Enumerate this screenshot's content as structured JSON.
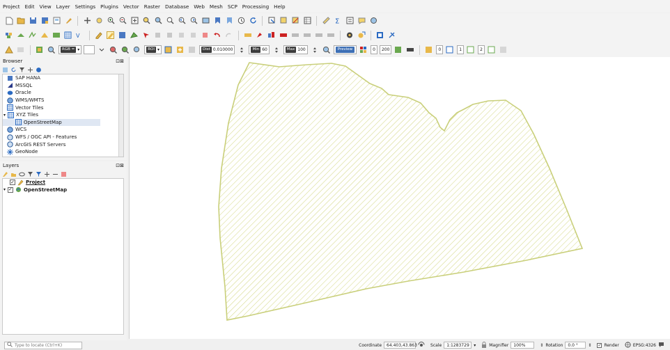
{
  "menubar": [
    "Project",
    "Edit",
    "View",
    "Layer",
    "Settings",
    "Plugins",
    "Vector",
    "Raster",
    "Database",
    "Web",
    "Mesh",
    "SCP",
    "Processing",
    "Help"
  ],
  "toolbar3": {
    "rgb_label": "RGB =",
    "roi_label": "ROI",
    "dist_label": "Dist",
    "dist_value": "0.010000",
    "min_label": "Min",
    "min_value": "60",
    "max_label": "Max",
    "max_value": "100",
    "preview_label": "Preview",
    "band_value": "0",
    "size_value": "200",
    "spin1": "0",
    "spin2": "1",
    "spin3": "2"
  },
  "browser": {
    "title": "Browser",
    "items": [
      {
        "label": "SAP HANA",
        "icon": "database-icon"
      },
      {
        "label": "MSSQL",
        "icon": "mssql-icon"
      },
      {
        "label": "Oracle",
        "icon": "oracle-icon"
      },
      {
        "label": "WMS/WMTS",
        "icon": "globe-icon"
      },
      {
        "label": "Vector Tiles",
        "icon": "grid-icon"
      },
      {
        "label": "XYZ Tiles",
        "icon": "grid-icon"
      },
      {
        "label": "OpenStreetMap",
        "icon": "grid-icon"
      },
      {
        "label": "WCS",
        "icon": "globe-icon"
      },
      {
        "label": "WFS / OGC API - Features",
        "icon": "globe-icon"
      },
      {
        "label": "ArcGIS REST Servers",
        "icon": "globe-icon"
      },
      {
        "label": "GeoNode",
        "icon": "geonode-icon"
      }
    ]
  },
  "layers": {
    "title": "Layers",
    "items": [
      {
        "label": "Project",
        "checked": true,
        "icon": "pencil-icon"
      },
      {
        "label": "OpenStreetMap",
        "checked": true,
        "icon": "osm-icon"
      }
    ]
  },
  "colors": {
    "polygon_stroke": "#c9cf7a",
    "hatch": "#d6d98a"
  },
  "status": {
    "locate_placeholder": "Type to locate (Ctrl+K)",
    "coordinate_label": "Coordinate",
    "coordinate_value": "64.403,43.863",
    "scale_label": "Scale",
    "scale_value": "1:1283729",
    "magnifier_label": "Magnifier",
    "magnifier_value": "100%",
    "rotation_label": "Rotation",
    "rotation_value": "0.0 °",
    "render_label": "Render",
    "crs_value": "EPSG:4326"
  }
}
